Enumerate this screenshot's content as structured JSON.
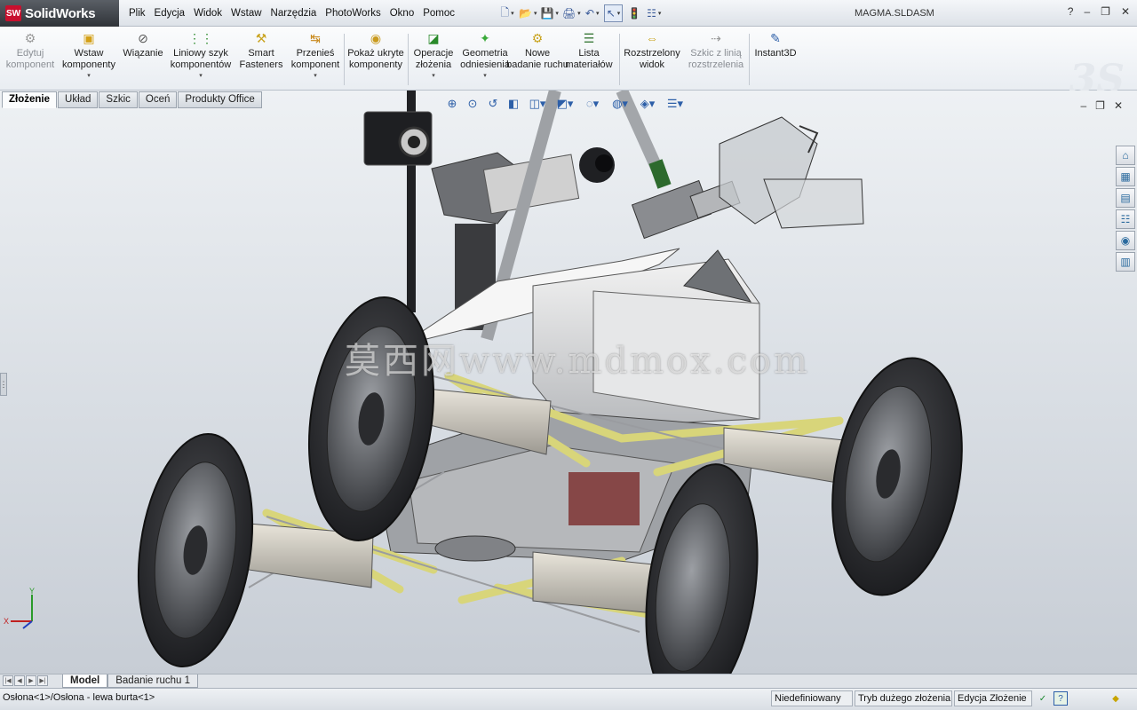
{
  "app": {
    "logo_mark": "SW",
    "name": "SolidWorks",
    "document_title": "MAGMA.SLDASM"
  },
  "menu": [
    "Plik",
    "Edycja",
    "Widok",
    "Wstaw",
    "Narzędzia",
    "PhotoWorks",
    "Okno",
    "Pomoc"
  ],
  "quick_toolbar": [
    {
      "name": "new-document",
      "glyph": "🗋"
    },
    {
      "name": "open-document",
      "glyph": "📂"
    },
    {
      "name": "save",
      "glyph": "💾"
    },
    {
      "name": "print",
      "glyph": "🖨"
    },
    {
      "name": "undo",
      "glyph": "↶"
    },
    {
      "name": "select",
      "glyph": "↖"
    },
    {
      "name": "rebuild",
      "glyph": "🚦"
    },
    {
      "name": "options",
      "glyph": "☷"
    }
  ],
  "window_controls": {
    "help": "?",
    "minimize": "–",
    "restore": "❐",
    "close": "✕"
  },
  "ribbon": {
    "buttons": [
      {
        "id": "edit-component",
        "label": "Edytuj komponent",
        "disabled": true,
        "dropdown": false
      },
      {
        "id": "insert-components",
        "label": "Wstaw komponenty",
        "disabled": false,
        "dropdown": true
      },
      {
        "id": "mate",
        "label": "Wiązanie",
        "disabled": false,
        "dropdown": false
      },
      {
        "id": "linear-pattern",
        "label": "Liniowy szyk komponentów",
        "disabled": false,
        "dropdown": true
      },
      {
        "id": "smart-fasteners",
        "label": "Smart Fasteners",
        "disabled": false,
        "dropdown": false
      },
      {
        "id": "move-component",
        "label": "Przenieś komponent",
        "disabled": false,
        "dropdown": true
      },
      {
        "id": "show-hidden",
        "label": "Pokaż ukryte komponenty",
        "disabled": false,
        "dropdown": false
      },
      {
        "id": "assembly-features",
        "label": "Operacje złożenia",
        "disabled": false,
        "dropdown": true
      },
      {
        "id": "reference-geometry",
        "label": "Geometria odniesienia",
        "disabled": false,
        "dropdown": true
      },
      {
        "id": "new-motion-study",
        "label": "Nowe badanie ruchu",
        "disabled": false,
        "dropdown": false
      },
      {
        "id": "bill-of-materials",
        "label": "Lista materiałów",
        "disabled": false,
        "dropdown": false
      },
      {
        "id": "exploded-view",
        "label": "Rozstrzelony widok",
        "disabled": false,
        "dropdown": false
      },
      {
        "id": "explode-line-sketch",
        "label": "Szkic z linią rozstrzelenia",
        "disabled": true,
        "dropdown": false
      },
      {
        "id": "instant3d",
        "label": "Instant3D",
        "disabled": false,
        "dropdown": false
      }
    ]
  },
  "command_tabs": [
    "Złożenie",
    "Układ",
    "Szkic",
    "Oceń",
    "Produkty Office"
  ],
  "active_command_tab": "Złożenie",
  "viewport": {
    "watermark": "莫西网www.mdmox.com",
    "heads_up_toolbar": [
      "zoom-to-fit-icon",
      "zoom-area-icon",
      "previous-view-icon",
      "section-view-icon",
      "view-orientation-icon",
      "display-style-icon",
      "hide-show-icon",
      "edit-appearance-icon",
      "apply-scene-icon",
      "view-settings-icon"
    ],
    "task_pane": [
      "home-icon",
      "design-library-icon",
      "file-explorer-icon",
      "view-palette-icon",
      "appearances-icon",
      "custom-properties-icon"
    ],
    "triad": {
      "x": "X",
      "y": "Y"
    }
  },
  "bottom_tabs": [
    "Model",
    "Badanie ruchu 1"
  ],
  "active_bottom_tab": "Model",
  "status": {
    "message": "Osłona<1>/Osłona - lewa burta<1>",
    "fields": [
      "Niedefiniowany",
      "Tryb dużego złożenia",
      "Edycja Złożenie"
    ]
  },
  "colors": {
    "accent": "#2d5fa8",
    "brand": "#c8102e",
    "strut": "#d8d57a",
    "tire": "#2c2d30"
  }
}
